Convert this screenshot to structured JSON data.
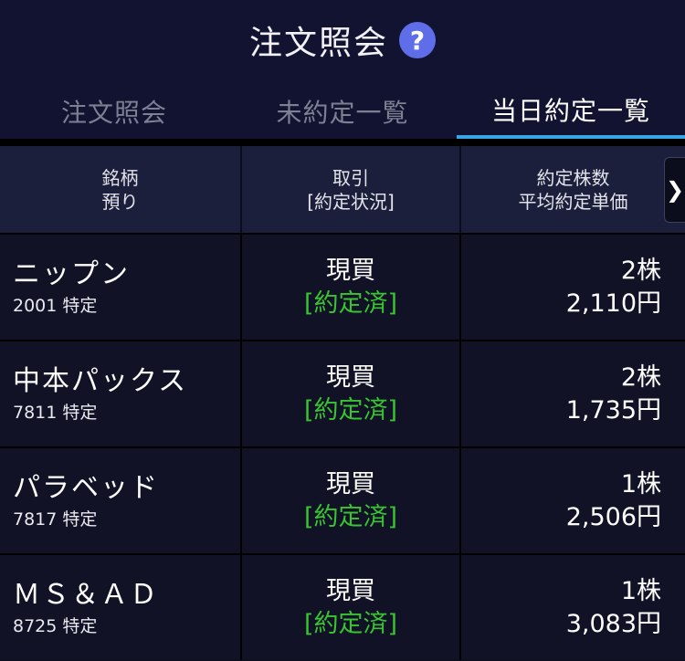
{
  "header": {
    "title": "注文照会",
    "help_icon": "?"
  },
  "tabs": [
    {
      "label": "注文照会",
      "active": false
    },
    {
      "label": "未約定一覧",
      "active": false
    },
    {
      "label": "当日約定一覧",
      "active": true
    }
  ],
  "table": {
    "columns": [
      {
        "line1": "銘柄",
        "line2": "預り"
      },
      {
        "line1": "取引",
        "line2": "[約定状況]"
      },
      {
        "line1": "約定株数",
        "line2": "平均約定単価"
      }
    ],
    "scroll_glyph": "❯",
    "rows": [
      {
        "name": "ニップン",
        "code": "2001 特定",
        "trade": "現買",
        "status": "[約定済]",
        "qty": "2株",
        "price": "2,110円"
      },
      {
        "name": "中本パックス",
        "code": "7811 特定",
        "trade": "現買",
        "status": "[約定済]",
        "qty": "2株",
        "price": "1,735円"
      },
      {
        "name": "パラベッド",
        "code": "7817 特定",
        "trade": "現買",
        "status": "[約定済]",
        "qty": "1株",
        "price": "2,506円"
      },
      {
        "name": "ＭＳ＆ＡＤ",
        "code": "8725 特定",
        "trade": "現買",
        "status": "[約定済]",
        "qty": "1株",
        "price": "3,083円"
      }
    ]
  },
  "colors": {
    "background": "#0b0c1c",
    "header_bg": "#111331",
    "table_header_bg": "#1b1f3b",
    "active_tab_underline": "#37a6e6",
    "status_green": "#39c432",
    "help_icon_bg": "#5f6ee8"
  }
}
